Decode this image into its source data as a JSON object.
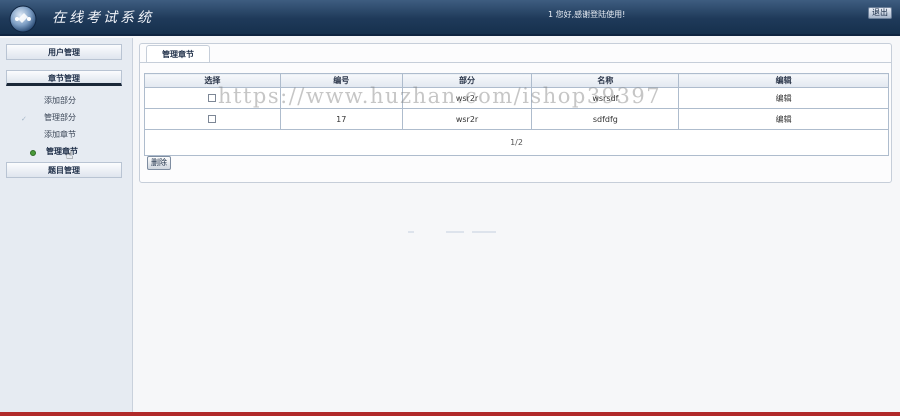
{
  "header": {
    "app_title": "在线考试系统",
    "greeting": "1 您好,感谢登陆使用!",
    "logout_label": "退出"
  },
  "sidebar": {
    "user_mgmt_label": "用户管理",
    "chapter_mgmt_label": "章节管理",
    "items": [
      {
        "label": "添加部分"
      },
      {
        "label": "管理部分"
      },
      {
        "label": "添加章节"
      },
      {
        "label": "管理章节"
      }
    ],
    "question_mgmt_label": "题目管理"
  },
  "main": {
    "tab_label": "管理章节",
    "table": {
      "headers": [
        "选择",
        "编号",
        "部分",
        "名称",
        "编辑"
      ],
      "rows": [
        {
          "id": "",
          "part": "wsr2r",
          "name": "wsrsdf",
          "edit": "编辑"
        },
        {
          "id": "17",
          "part": "wsr2r",
          "name": "sdfdfg",
          "edit": "编辑"
        }
      ],
      "pager": "1/2"
    },
    "delete_label": "删除"
  },
  "watermark": "https://www.huzhan.com/ishop39397",
  "colors": {
    "header_bg": "#1f3a5a",
    "sidebar_bg": "#e6ebf2",
    "table_border": "#aebccd",
    "active_bullet": "#4a9a3a",
    "bottom_line": "#b12a2a"
  }
}
